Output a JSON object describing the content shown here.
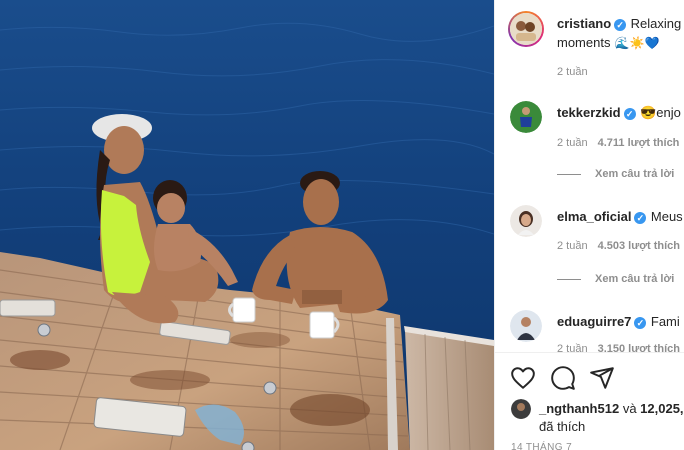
{
  "post": {
    "author": "cristiano",
    "caption_start": "Relaxing",
    "caption_cont": "moments",
    "caption_emojis": "🌊☀️💙",
    "time": "2 tuần"
  },
  "comments": [
    {
      "username": "tekkerzkid",
      "text_start": "😎enjo",
      "time": "2 tuần",
      "likes": "4.711 lượt thích"
    },
    {
      "username": "elma_oficial",
      "text_start": "Meus",
      "time": "2 tuần",
      "likes": "4.503 lượt thích"
    },
    {
      "username": "eduaguirre7",
      "text_start": "Fami",
      "time": "2 tuần",
      "likes": "3.150 lượt thích"
    }
  ],
  "replies_label": "Xem câu trả lời",
  "actions": {
    "like_icon": "heart-icon",
    "comment_icon": "comment-icon",
    "share_icon": "share-icon"
  },
  "likes": {
    "liker": "_ngthanh512",
    "connector": "và",
    "count": "12,025,",
    "suffix": "đã thích"
  },
  "date": "14 THÁNG 7",
  "colors": {
    "verified": "#3897f0",
    "meta_text": "#8e8e8e",
    "text": "#262626",
    "sea": "#123c78",
    "deck": "#c9a27f"
  }
}
